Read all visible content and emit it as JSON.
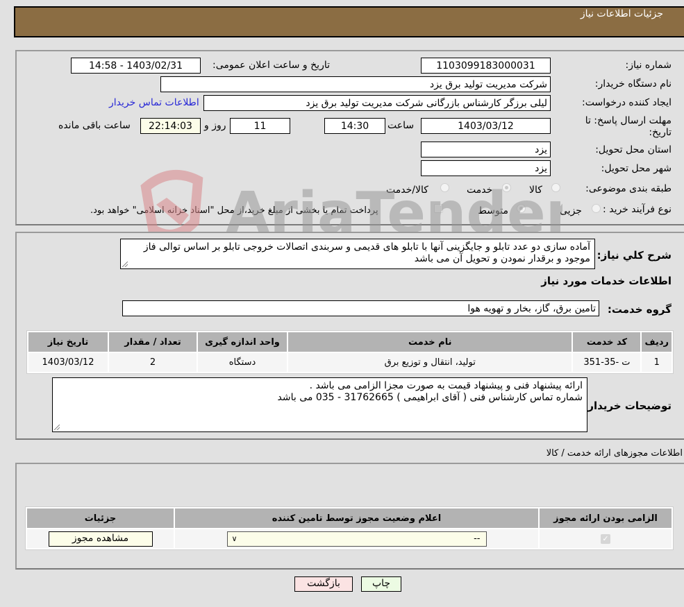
{
  "header": {
    "title": "جزئیات اطلاعات نیاز"
  },
  "form": {
    "need_number": {
      "label": "شماره نیاز:",
      "value": "1103099183000031"
    },
    "announce": {
      "label": "تاریخ و ساعت اعلان عمومی:",
      "value": "1403/02/31 - 14:58"
    },
    "buyer_org": {
      "label": "نام دستگاه خریدار:",
      "value": "شرکت مدیریت تولید برق یزد"
    },
    "creator": {
      "label": "ایجاد کننده درخواست:",
      "value": "لیلی برزگر کارشناس بازرگانی شرکت مدیریت تولید برق یزد"
    },
    "contact_link": "اطلاعات تماس خریدار",
    "deadline": {
      "label": "مهلت ارسال پاسخ: تا تاریخ:",
      "date": "1403/03/12",
      "time_label": "ساعت",
      "time": "14:30",
      "days": "11",
      "days_label": "روز و",
      "remaining": "22:14:03",
      "remaining_label": "ساعت باقی مانده"
    },
    "province": {
      "label": "استان محل تحویل:",
      "value": "یزد"
    },
    "city": {
      "label": "شهر محل تحویل:",
      "value": "یزد"
    },
    "category": {
      "label": "طبقه بندی موضوعی:",
      "options": [
        "کالا",
        "خدمت",
        "کالا/خدمت"
      ],
      "selected": "خدمت"
    },
    "process": {
      "label": "نوع فرآیند خرید :",
      "options": [
        "جزیی",
        "متوسط"
      ],
      "selected": "متوسط",
      "payment_note": "پرداخت تمام یا بخشی از مبلغ خرید،از محل \"اسناد خزانه اسلامی\" خواهد بود."
    }
  },
  "description": {
    "label": "شرح کلي نیاز:",
    "value": "آماده سازی دو عدد تابلو و جایگزینی آنها با تابلو های قدیمی و سربندی اتصالات خروجی تابلو بر اساس توالی فاز موجود و برقدار نمودن و تحویل آن می باشد"
  },
  "services": {
    "section_title": "اطلاعات خدمات مورد نیاز",
    "group_label": "گروه خدمت:",
    "group_value": "تامین برق، گاز، بخار و تهویه هوا",
    "columns": [
      "ردیف",
      "کد خدمت",
      "نام خدمت",
      "واحد اندازه گیری",
      "تعداد / مقدار",
      "تاریخ نیاز"
    ],
    "rows": [
      {
        "row": "1",
        "code": "ت -35-351",
        "name": "تولید، انتقال و توزیع برق",
        "unit": "دستگاه",
        "qty": "2",
        "date": "1403/03/12"
      }
    ]
  },
  "buyer_notes": {
    "label": "توضیحات خریدار:",
    "line1": "ارائه پیشنهاد فنی و پیشنهاد قیمت به صورت مجزا الزامی می باشد .",
    "line2": "شماره تماس کارشناس فنی ( آقای ابراهیمی ) 31762665 - 035 می باشد"
  },
  "permits": {
    "section_title": "اطلاعات مجوزهای ارائه خدمت / کالا",
    "columns": [
      "الزامی بودن ارائه مجوز",
      "اعلام وضعیت مجوز توسط تامین کننده",
      "جزئیات"
    ],
    "rows": [
      {
        "required": true,
        "status": "--",
        "details_button": "مشاهده مجوز"
      }
    ]
  },
  "buttons": {
    "print": "چاپ",
    "back": "بازگشت"
  },
  "watermark": "AriaTender.neT"
}
